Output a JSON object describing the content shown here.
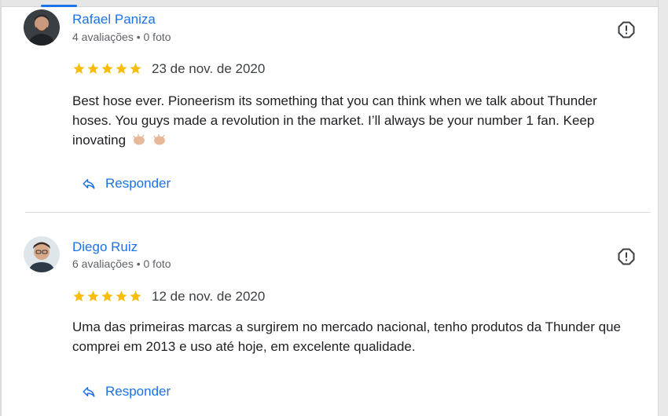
{
  "reviews": [
    {
      "name": "Rafael Paniza",
      "meta": "4 avaliações • 0 foto",
      "rating": 5,
      "date": "23 de nov. de 2020",
      "text": "Best hose ever. Pioneerism its something that you can think when we talk about Thunder hoses. You guys made a revolution in the market. I’ll always be your number 1 fan. Keep inovating",
      "reply_label": "Responder"
    },
    {
      "name": "Diego Ruiz",
      "meta": "6 avaliações • 0 foto",
      "rating": 5,
      "date": "12 de nov. de 2020",
      "text": "Uma das primeiras marcas a surgirem no mercado nacional, tenho produtos da Thunder que comprei em 2013 e uso até hoje, em excelente qualidade.",
      "reply_label": "Responder"
    }
  ],
  "colors": {
    "accent": "#1a73e8",
    "star": "#fbbc04",
    "meta": "#5f6368"
  },
  "icons": {
    "flag": "report-icon",
    "reply": "reply-arrow-icon",
    "star": "star-icon",
    "emoji": "clapping-hands-icon"
  }
}
